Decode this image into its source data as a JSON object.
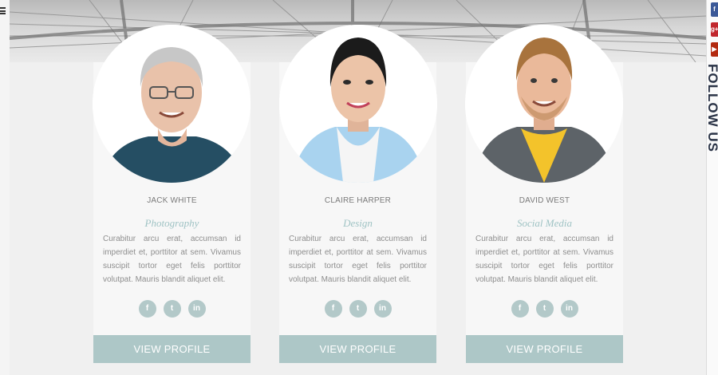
{
  "sidebar": {
    "menu_icon": "hamburger-icon"
  },
  "follow": {
    "label": "FOLLOW US",
    "buttons": [
      {
        "icon": "facebook-icon",
        "glyph": "f",
        "color": "#3b5998"
      },
      {
        "icon": "google-plus-icon",
        "glyph": "g+",
        "color": "#c1272d"
      },
      {
        "icon": "youtube-icon",
        "glyph": "▶",
        "color": "#b32a10"
      }
    ]
  },
  "team": [
    {
      "name": "JACK WHITE",
      "role": "Photography",
      "description": "Curabitur arcu erat, accumsan id imperdiet et, porttitor at sem. Vivamus suscipit tortor eget felis porttitor volutpat. Mauris blandit aliquet elit.",
      "socials": [
        {
          "icon": "facebook-icon",
          "glyph": "f"
        },
        {
          "icon": "twitter-icon",
          "glyph": "t"
        },
        {
          "icon": "linkedin-icon",
          "glyph": "in"
        }
      ],
      "button": "VIEW PROFILE"
    },
    {
      "name": "CLAIRE HARPER",
      "role": "Design",
      "description": "Curabitur arcu erat, accumsan id imperdiet et, porttitor at sem. Vivamus suscipit tortor eget felis porttitor volutpat. Mauris blandit aliquet elit.",
      "socials": [
        {
          "icon": "facebook-icon",
          "glyph": "f"
        },
        {
          "icon": "twitter-icon",
          "glyph": "t"
        },
        {
          "icon": "linkedin-icon",
          "glyph": "in"
        }
      ],
      "button": "VIEW PROFILE"
    },
    {
      "name": "DAVID WEST",
      "role": "Social Media",
      "description": "Curabitur arcu erat, accumsan id imperdiet et, porttitor at sem. Vivamus suscipit tortor eget felis porttitor volutpat. Mauris blandit aliquet elit.",
      "socials": [
        {
          "icon": "facebook-icon",
          "glyph": "f"
        },
        {
          "icon": "twitter-icon",
          "glyph": "t"
        },
        {
          "icon": "linkedin-icon",
          "glyph": "in"
        }
      ],
      "button": "VIEW PROFILE"
    }
  ],
  "colors": {
    "accent": "#adc7c7",
    "role_text": "#9fc3c4",
    "social_circle": "#b3c9c9"
  }
}
